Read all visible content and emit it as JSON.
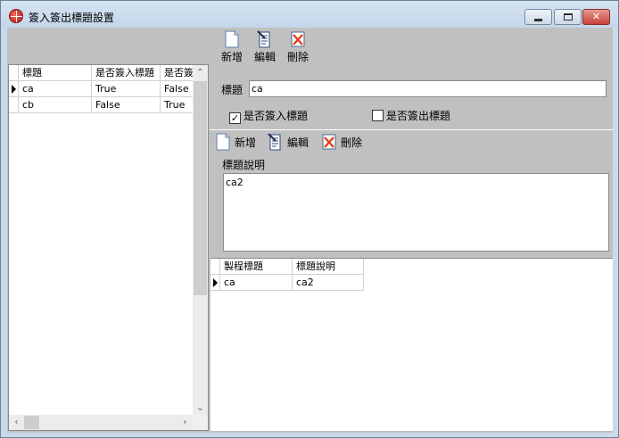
{
  "window": {
    "title": "簽入簽出標題設置"
  },
  "toolbar": [
    {
      "label": "新增",
      "icon": "new-document-icon"
    },
    {
      "label": "編輯",
      "icon": "edit-document-icon"
    },
    {
      "label": "刪除",
      "icon": "delete-icon"
    }
  ],
  "left_grid": {
    "columns": [
      "標題",
      "是否簽入標題",
      "是否簽"
    ],
    "rows": [
      {
        "cells": [
          "ca",
          "True",
          "False"
        ],
        "current": true
      },
      {
        "cells": [
          "cb",
          "False",
          "True"
        ],
        "current": false
      }
    ]
  },
  "detail": {
    "title_label": "標題",
    "title_value": "ca",
    "checkin_label": "是否簽入標題",
    "checkin_checked": true,
    "checkout_label": "是否簽出標題",
    "checkout_checked": false
  },
  "sub_toolbar": [
    {
      "label": "新增",
      "icon": "new-document-icon"
    },
    {
      "label": "編輯",
      "icon": "edit-document-icon"
    },
    {
      "label": "刪除",
      "icon": "delete-icon"
    }
  ],
  "description": {
    "label": "標題說明",
    "value": "ca2"
  },
  "bottom_grid": {
    "columns": [
      "製程標題",
      "標題說明"
    ],
    "rows": [
      {
        "cells": [
          "ca",
          "ca2"
        ],
        "current": true
      }
    ]
  },
  "colors": {
    "panel": "#c0c0c0",
    "titlebar": "#c9daea",
    "close": "#c6413a"
  }
}
